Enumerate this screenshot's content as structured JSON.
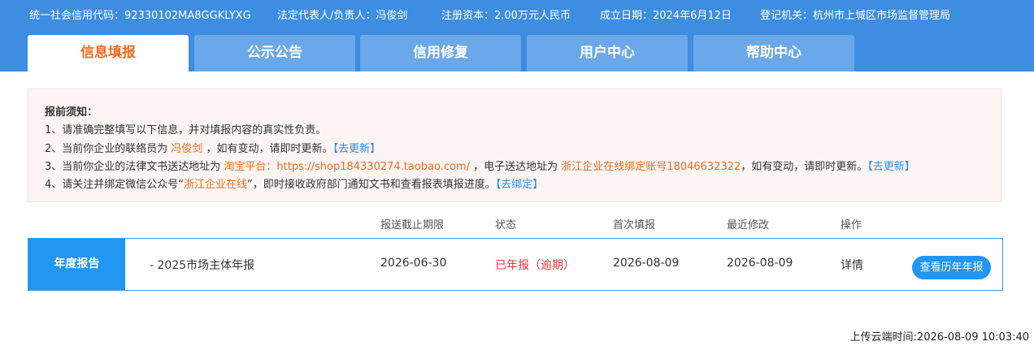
{
  "header": {
    "credit_code": "统一社会信用代码：92330102MA8GGKLYXG",
    "legal_rep": "法定代表人/负责人：冯俊剑",
    "capital": "注册资本：2.00万元人民币",
    "established": "成立日期：2024年6月12日",
    "authority": "登记机关：杭州市上城区市场监督管理局"
  },
  "tabs": [
    {
      "label": "信息填报"
    },
    {
      "label": "公示公告"
    },
    {
      "label": "信用修复"
    },
    {
      "label": "用户中心"
    },
    {
      "label": "帮助中心"
    }
  ],
  "notice": {
    "title": "报前须知：",
    "line1": "1、请准确完整填写以下信息，并对填报内容的真实性负责。",
    "line2_prefix": "2、当前你企业的联络员为 ",
    "line2_name": "冯俊剑",
    "line2_suffix": " ，如有变动，请即时更新。",
    "line2_link": "【去更新】",
    "line3_prefix": "3、当前你企业的法律文书送达地址为 ",
    "line3_addr": "淘宝平台：https://shop184330274.taobao.com/",
    "line3_mid": " ，电子送达地址为 ",
    "line3_eaddr": "浙江企业在线绑定账号18046632322",
    "line3_suffix": "，如有变动，请即时更新。",
    "line3_link": "【去更新】",
    "line4_prefix": "4、请关注并绑定微信公众号“",
    "line4_name": "浙江企业在线",
    "line4_suffix": "”，即时接收政府部门通知文书和查看报表填报进度。",
    "line4_link": "【去绑定】"
  },
  "table": {
    "headers": {
      "deadline": "报送截止期限",
      "status": "状态",
      "first": "首次填报",
      "modified": "最近修改",
      "ops": "操作"
    },
    "row": {
      "label": "年度报告",
      "name": "- 2025市场主体年报",
      "deadline": "2026-06-30",
      "status": "已年报（逾期）",
      "first": "2026-08-09",
      "modified": "2026-08-09",
      "detail": "详情",
      "history": "查看历年年报"
    }
  },
  "footer": {
    "upload_time": "上传云端时间:2026-08-09 10:03:40"
  },
  "colors": {
    "header_bg": "#3d8de0",
    "tab_inactive": "#6aa8e9",
    "accent_orange": "#ef6c24",
    "link_blue": "#2b8ee5",
    "status_red": "#e53935",
    "button_blue": "#2196f3"
  }
}
